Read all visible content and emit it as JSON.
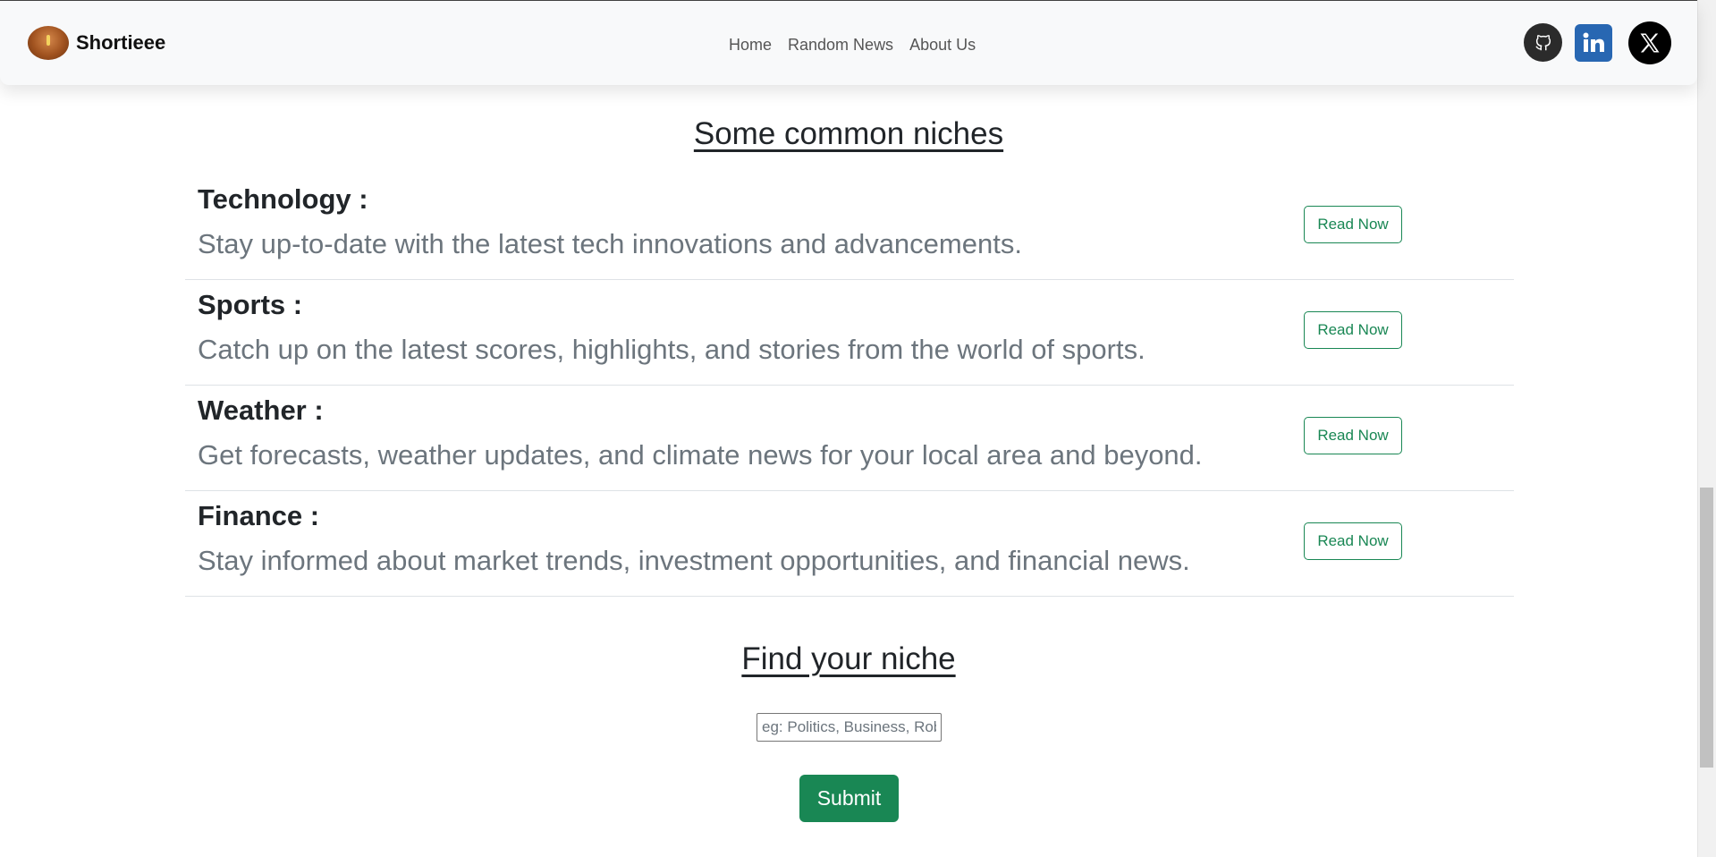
{
  "navbar": {
    "brand": "Shortieee",
    "links": [
      {
        "label": "Home"
      },
      {
        "label": "Random News"
      },
      {
        "label": "About Us"
      }
    ],
    "social_icons": [
      "github-icon",
      "linkedin-icon",
      "x-icon"
    ]
  },
  "niches": {
    "title": "Some common niches",
    "items": [
      {
        "name": "Technology :",
        "description": "Stay up-to-date with the latest tech innovations and advancements.",
        "button": "Read Now"
      },
      {
        "name": "Sports :",
        "description": "Catch up on the latest scores, highlights, and stories from the world of sports.",
        "button": "Read Now"
      },
      {
        "name": "Weather :",
        "description": "Get forecasts, weather updates, and climate news for your local area and beyond.",
        "button": "Read Now"
      },
      {
        "name": "Finance :",
        "description": "Stay informed about market trends, investment opportunities, and financial news.",
        "button": "Read Now"
      }
    ]
  },
  "find": {
    "title": "Find your niche",
    "placeholder": "eg: Politics, Business, Robotics",
    "value": "",
    "submit": "Submit"
  },
  "colors": {
    "accent": "#198754",
    "navbar_bg": "#f8f9fa",
    "muted_text": "#6c757d"
  }
}
